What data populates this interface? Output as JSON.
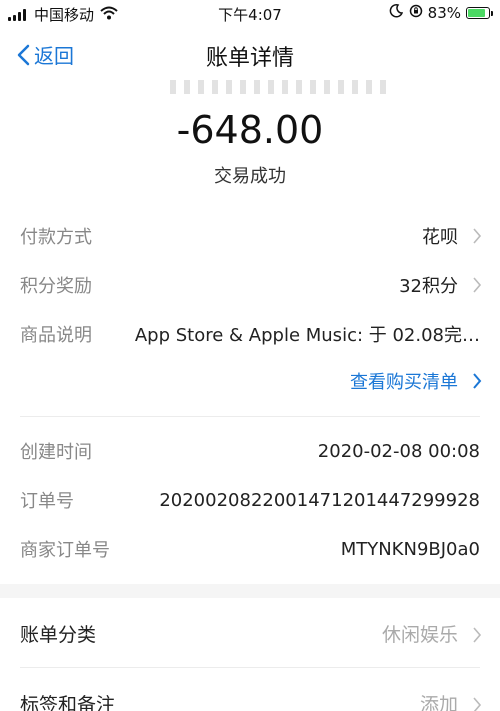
{
  "status_bar": {
    "carrier": "中国移动",
    "time": "下午4:07",
    "battery_percent": "83%",
    "battery_level": 0.83
  },
  "nav": {
    "back_label": "返回",
    "title": "账单详情"
  },
  "header": {
    "amount": "-648.00",
    "status": "交易成功"
  },
  "details": [
    {
      "label": "付款方式",
      "value": "花呗",
      "arrow": true
    },
    {
      "label": "积分奖励",
      "value": "32积分",
      "arrow": true
    },
    {
      "label": "商品说明",
      "value": "App Store & Apple Music: 于 02.08完…",
      "arrow": false
    }
  ],
  "purchase_list_link": "查看购买清单",
  "order_info": [
    {
      "label": "创建时间",
      "value": "2020-02-08 00:08"
    },
    {
      "label": "订单号",
      "value": "2020020822001471201447299928"
    },
    {
      "label": "商家订单号",
      "value": "MTYNKN9BJ0a0"
    }
  ],
  "bottom": [
    {
      "label": "账单分类",
      "value": "休闲娱乐"
    },
    {
      "label": "标签和备注",
      "value": "添加"
    }
  ],
  "colors": {
    "accent": "#1b77d6",
    "background": "#f5f5f5",
    "battery_green": "#4cd964"
  }
}
